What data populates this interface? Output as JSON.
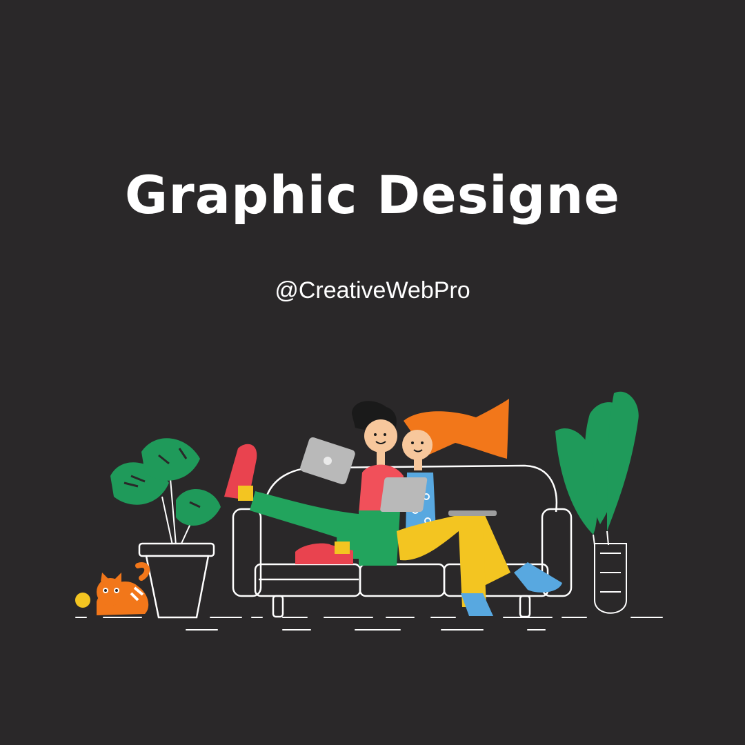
{
  "header": {
    "title": "Graphic Designe",
    "handle": "@CreativeWebPro"
  },
  "colors": {
    "background": "#2a2829",
    "text": "#ffffff",
    "line_art": "#ffffff",
    "plant_green": "#1f9a5a",
    "hair_orange": "#f2771a",
    "pants_yellow": "#f3c521",
    "pants_green": "#22a45d",
    "shirt_red": "#f1505a",
    "shoe_red": "#e9434f",
    "top_blue": "#58a8e0",
    "laptop_gray": "#b9b9b9",
    "skin": "#f7c79c",
    "cat_orange": "#f2771a"
  },
  "illustration": {
    "icons": [
      "monstera-plant-icon",
      "tall-leaf-plant-icon",
      "sofa-icon",
      "cat-icon",
      "person-man-icon",
      "person-woman-icon",
      "tablet-icon",
      "laptop-icon"
    ]
  }
}
